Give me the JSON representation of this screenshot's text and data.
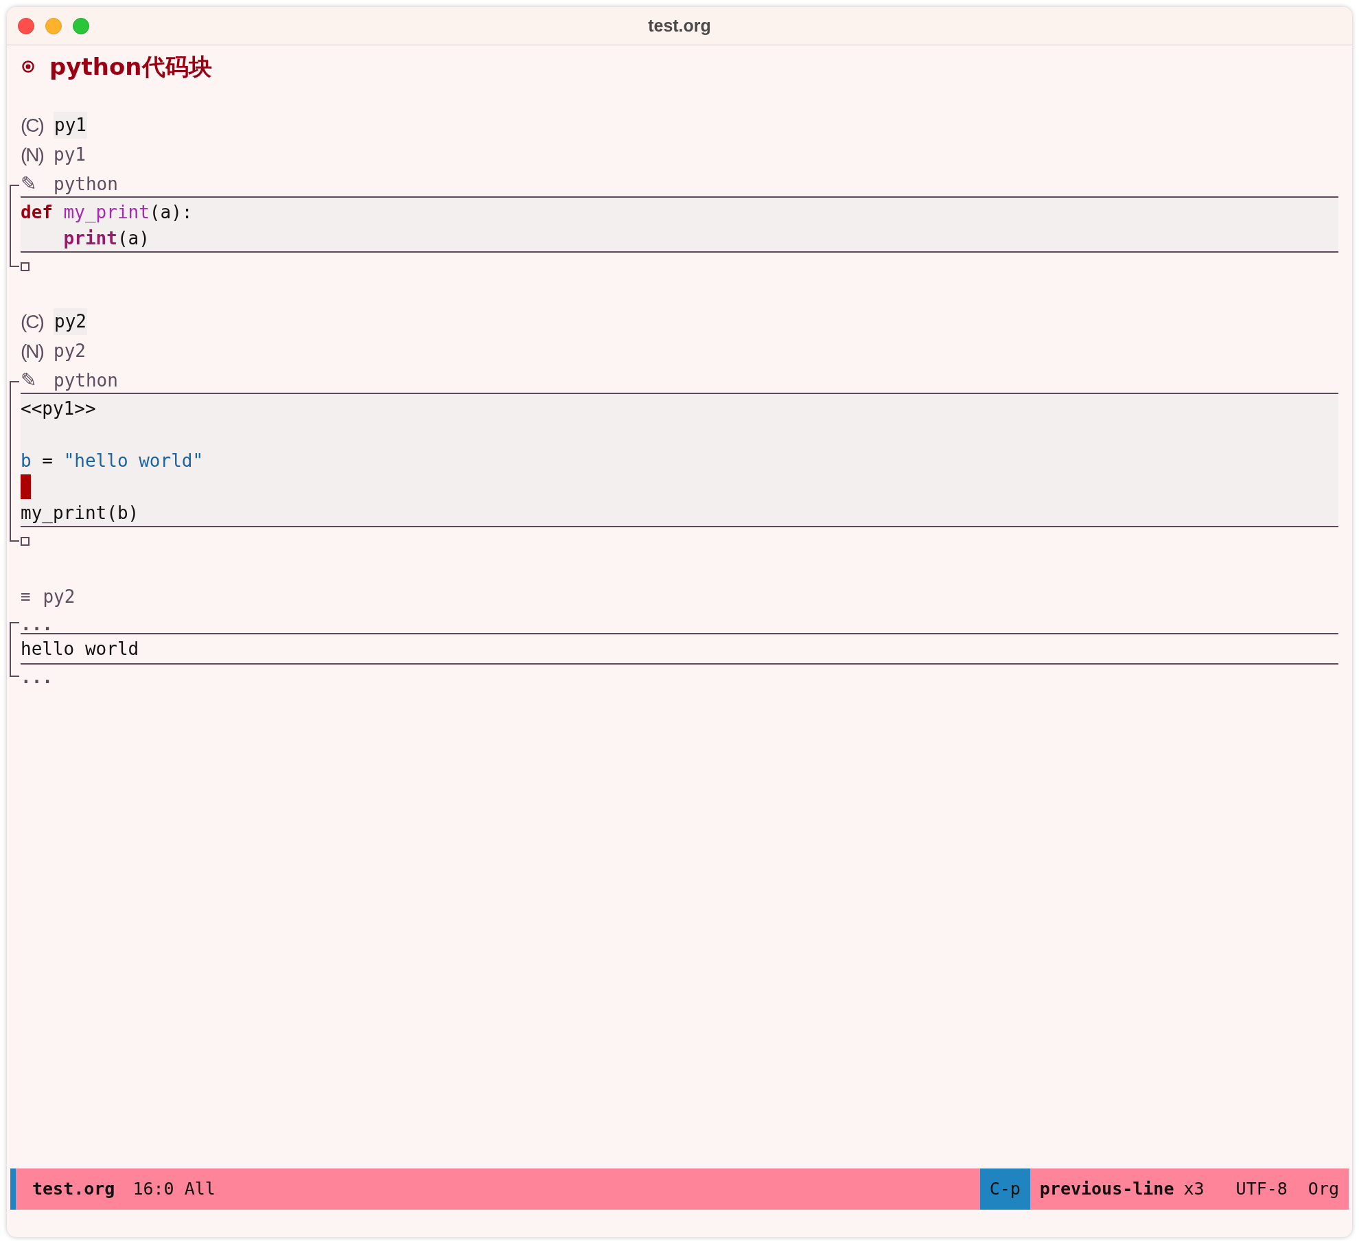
{
  "window": {
    "title": "test.org"
  },
  "heading": {
    "text": "python代码块"
  },
  "blocks": [
    {
      "call": {
        "tag": "(C)",
        "value": "py1"
      },
      "name": {
        "tag": "(N)",
        "value": "py1"
      },
      "header": {
        "icon": "✎",
        "language": "python"
      },
      "lines": [
        {
          "kind": "code",
          "tokens": [
            {
              "text": "def",
              "kind": "keyword"
            },
            {
              "text": " my_print",
              "kind": "function"
            },
            {
              "text": "(a):",
              "kind": "plain"
            }
          ]
        },
        {
          "kind": "code",
          "tokens": [
            {
              "text": "    print",
              "kind": "builtin"
            },
            {
              "text": "(a)",
              "kind": "plain"
            }
          ]
        }
      ]
    },
    {
      "call": {
        "tag": "(C)",
        "value": "py2"
      },
      "name": {
        "tag": "(N)",
        "value": "py2"
      },
      "header": {
        "icon": "✎",
        "language": "python"
      },
      "lines": [
        {
          "kind": "code",
          "tokens": [
            {
              "text": "<<py1>>",
              "kind": "plain"
            }
          ]
        },
        {
          "kind": "blank"
        },
        {
          "kind": "code",
          "tokens": [
            {
              "text": "b",
              "kind": "variable"
            },
            {
              "text": " = ",
              "kind": "plain"
            },
            {
              "text": "\"hello world\"",
              "kind": "string"
            }
          ]
        },
        {
          "kind": "cursor"
        },
        {
          "kind": "code",
          "tokens": [
            {
              "text": "my_print(b)",
              "kind": "plain"
            }
          ]
        }
      ]
    }
  ],
  "results": {
    "marker": "≡",
    "name": "py2",
    "open": "...",
    "close": "...",
    "lines": [
      "hello world"
    ]
  },
  "status_bar": {
    "buffer": "test.org",
    "position": "16:0 All",
    "key": "C-p",
    "command": "previous-line",
    "repeat": "x3",
    "encoding": "UTF-8",
    "mode": "Org"
  }
}
